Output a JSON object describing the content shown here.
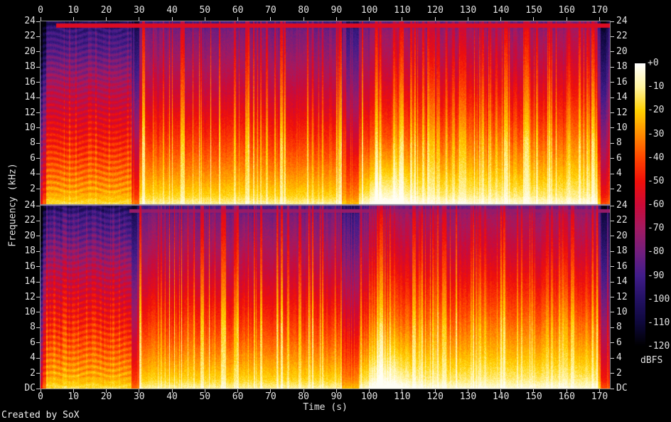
{
  "credit": "Created by SoX",
  "chart_data": {
    "type": "heatmap",
    "subtype": "audio-spectrogram",
    "title": "",
    "xlabel": "Time (s)",
    "ylabel": "Frequency (kHz)",
    "colorbar_label": "dBFS",
    "channels": 2,
    "duration_s": 173,
    "x_ticks_s": [
      0,
      10,
      20,
      30,
      40,
      50,
      60,
      70,
      80,
      90,
      100,
      110,
      120,
      130,
      140,
      150,
      160,
      170
    ],
    "freq_max_khz": 24,
    "freq_tick_khz": [
      24,
      22,
      20,
      18,
      16,
      14,
      12,
      10,
      8,
      6,
      4,
      2
    ],
    "dc_label": "DC",
    "db_range": [
      0,
      -120
    ],
    "db_tick_labels": [
      "+0",
      "-10",
      "-20",
      "-30",
      "-40",
      "-50",
      "-60",
      "-70",
      "-80",
      "-90",
      "-100",
      "-110",
      "-120"
    ],
    "palette": [
      {
        "at": 0.0,
        "color": "#000000"
      },
      {
        "at": 0.083,
        "color": "#0e083c"
      },
      {
        "at": 0.167,
        "color": "#231164"
      },
      {
        "at": 0.25,
        "color": "#411c8a"
      },
      {
        "at": 0.333,
        "color": "#731e7e"
      },
      {
        "at": 0.417,
        "color": "#a31a62"
      },
      {
        "at": 0.5,
        "color": "#cc0a38"
      },
      {
        "at": 0.583,
        "color": "#f00f0a"
      },
      {
        "at": 0.667,
        "color": "#ff4600"
      },
      {
        "at": 0.75,
        "color": "#ff8c00"
      },
      {
        "at": 0.833,
        "color": "#ffd000"
      },
      {
        "at": 0.917,
        "color": "#fff4a0"
      },
      {
        "at": 1.0,
        "color": "#ffffff"
      }
    ],
    "separator_color": "#8c84a0",
    "features": {
      "intro_quiet_end_s": 1.6,
      "textured_section_s": [
        1.6,
        27.6
      ],
      "quiet_gap_1_s": [
        27.6,
        29.9
      ],
      "quiet_gap_2_s": [
        91.5,
        96.8
      ],
      "loud_section_start_s": 100,
      "outro_fade_start_s": 169.3,
      "end_dark_start_s": 170.3,
      "top_stripe_khz": 23.6,
      "top_stripe_start_s": 4.6
    }
  }
}
